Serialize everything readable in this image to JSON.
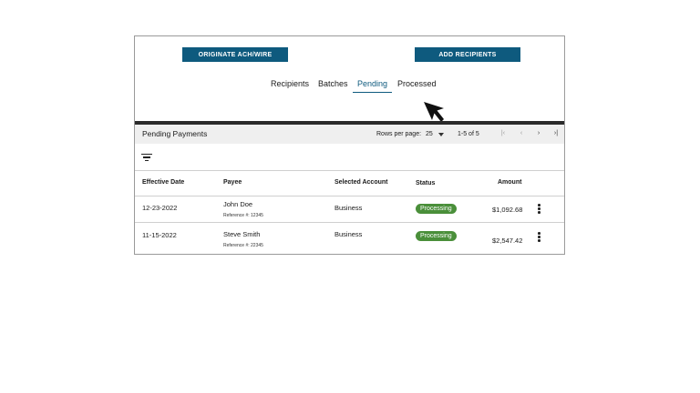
{
  "toolbar": {
    "originate_label": "ORIGINATE ACH/WIRE",
    "add_recipients_label": "ADD RECIPIENTS"
  },
  "tabs": [
    {
      "label": "Recipients",
      "active": false
    },
    {
      "label": "Batches",
      "active": false
    },
    {
      "label": "Pending",
      "active": true
    },
    {
      "label": "Processed",
      "active": false
    }
  ],
  "panel": {
    "title": "Pending Payments",
    "rows_per_page_label": "Rows per page:",
    "rows_per_page_value": "25",
    "range": "1-5 of 5",
    "pagination_icons": [
      "first-page-icon",
      "prev-page-icon",
      "next-page-icon",
      "last-page-icon"
    ]
  },
  "table": {
    "headers": [
      "Effective Date",
      "Payee",
      "Selected Account",
      "Status",
      "Amount"
    ],
    "rows": [
      {
        "date": "12-23-2022",
        "payee": "John Doe",
        "reference": "Reference #: 12345",
        "account": "Business",
        "status": "Processing",
        "amount": "$1,092.68"
      },
      {
        "date": "11-15-2022",
        "payee": "Steve Smith",
        "reference": "Reference #: 22345",
        "account": "Business",
        "status": "Processing",
        "amount": "$2,547.42"
      }
    ]
  },
  "colors": {
    "accent": "#0e5a7e",
    "status_processing": "#4a8f3a"
  }
}
